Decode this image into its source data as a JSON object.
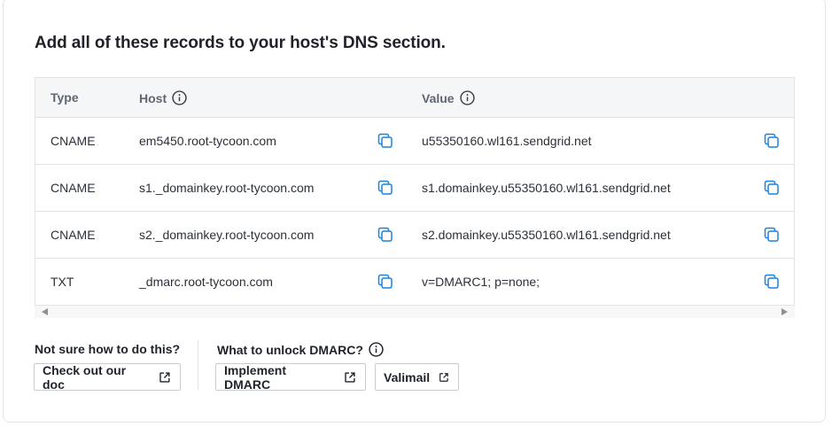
{
  "title": "Add all of these records to your host's DNS section.",
  "table": {
    "headers": {
      "type": "Type",
      "host": "Host",
      "value": "Value"
    },
    "rows": [
      {
        "type": "CNAME",
        "host": "em5450.root-tycoon.com",
        "value": "u55350160.wl161.sendgrid.net"
      },
      {
        "type": "CNAME",
        "host": "s1._domainkey.root-tycoon.com",
        "value": "s1.domainkey.u55350160.wl161.sendgrid.net"
      },
      {
        "type": "CNAME",
        "host": "s2._domainkey.root-tycoon.com",
        "value": "s2.domainkey.u55350160.wl161.sendgrid.net"
      },
      {
        "type": "TXT",
        "host": "_dmarc.root-tycoon.com",
        "value": "v=DMARC1; p=none;"
      }
    ]
  },
  "help": {
    "doc_question": "Not sure how to do this?",
    "doc_button": "Check out our doc",
    "dmarc_question": "What to unlock DMARC?",
    "dmarc_button": "Implement DMARC",
    "valimail_button": "Valimail"
  },
  "colors": {
    "icon_blue": "#1a82e2",
    "header_bg": "#f5f6f7",
    "border": "#e1e3e6"
  }
}
